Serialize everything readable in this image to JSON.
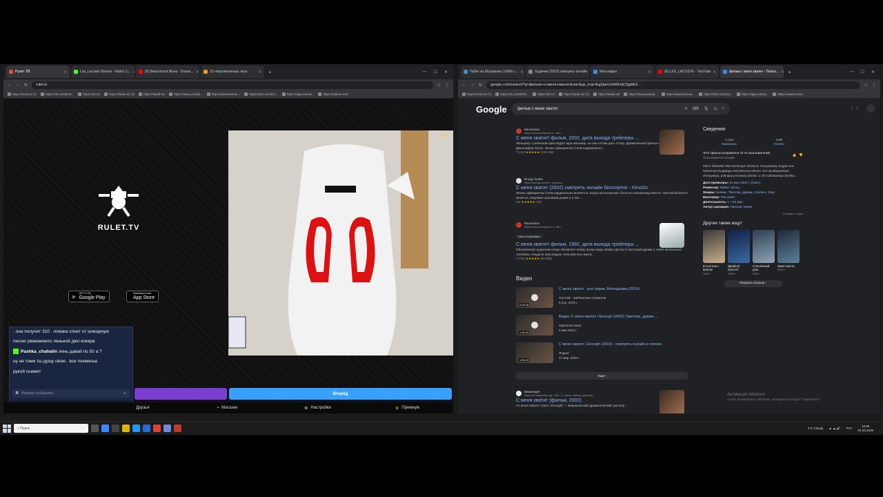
{
  "left_browser": {
    "tabs": [
      {
        "label": "Рулет ТВ",
        "color": "#e74c3c",
        "active": true
      },
      {
        "label": "Los_Lacoste Stream - Watch Li...",
        "color": "#53fc18",
        "active": false
      },
      {
        "label": "(8) Beauxtrrunt Blues - Ocean...",
        "color": "#ff0000",
        "active": false
      },
      {
        "label": "22 непрочитанных чата",
        "color": "#f39c12",
        "active": false
      }
    ],
    "url": "rulet.tv",
    "bookmarks": [
      "https://mail.ru/ (7)",
      "https://vk.com/al?8...",
      "https://ok.ru/",
      "https://tanki.su/ (7)",
      "https://twidd.su/",
      "https://www.youtub...",
      "https://www.itemsu...",
      "https://kick.com/lco...",
      "https://app.instrea...",
      "https://eteimo.mol..."
    ],
    "site": {
      "logo_text": "RULET.TV",
      "google_play": "Google Play",
      "google_play_small": "GET IT ON",
      "app_store": "App Store",
      "app_store_small": "Download on the",
      "video_badge": "★ 25",
      "chat": {
        "line1": ". она получит 310 . лояака споет от шикарную",
        "line2": "песню уважаемого ленькой джо кокера",
        "user": "Pashka_chahalin",
        "user_msg": "лень давай по 50 а ?",
        "line3": "ну не томи ты душу свою . все похмелье",
        "line4": "рукой снимит",
        "input_placeholder": "Напиши сообщение...",
        "footer_user": "Stream: Los_Lacoste",
        "footer_count": "1/1",
        "footer_viewers": "3"
      },
      "next_button": "Вперёд",
      "nav": {
        "friends": "Друзья",
        "shop": "Магазин",
        "settings": "Настройки",
        "premium": "Премиум"
      }
    }
  },
  "right_browser": {
    "tabs": [
      {
        "label": "Побег из Шоушенка (1994) с...",
        "color": "#3c8dde",
        "active": false
      },
      {
        "label": "Ходячие (2023) смотреть онлайн",
        "color": "#888888",
        "active": false
      },
      {
        "label": "Мои видео",
        "color": "#3c8dde",
        "active": false
      },
      {
        "label": "(8) LXD_LACOSTE - YouTube",
        "color": "#ff0000",
        "active": false
      },
      {
        "label": "фильм с меня хватит - Поиск...",
        "color": "#4285f4",
        "active": true
      }
    ],
    "url": "google.com/search?q=фильм+с+меня+хватит&oq=&gs_lcrp=EgZjaHJvbWUqCQgAEC...",
    "bookmarks": [
      "https://mail.ru/ (7)",
      "https://vk.com/al?8...",
      "https://ok.ru/",
      "https://tanki.su/ (7)",
      "https://twidd.su/",
      "https://www.youtub...",
      "https://www.itemsu...",
      "https://kick.com/lco...",
      "https://app.instrea...",
      "https://eteimo.mol..."
    ],
    "google": {
      "logo": "Google",
      "query": "фильм с меня хватит",
      "results": [
        {
          "source": "Кинопоиск",
          "src_url": "https://www.kinopoisk.ru › film",
          "title": "С меня хватит! фильм, 2002, дата выхода трейлеры ...",
          "snippet": "Женщину с ребенком преследует муж-абьюзер, но она готова дать отпор. Драматичный фильм-триллер с Дженнифер Лопес. Жизнь официантки Слим кардинально...",
          "rating": "7,1/10",
          "stars": "★★★★★",
          "votes": "(100 336)"
        },
        {
          "source": "kinogo media",
          "src_url": "https://kinogo.media › фильмы",
          "title": "С меня хватит (2002) смотреть онлайн бесплатно - KinoGo",
          "snippet": "Жизнь официантки Слим кардинально меняется, когда она встречает богатого незнакомца Митча. Они влюбляются, женятся, покупают красивый домик и у них ...",
          "rating": "3,9",
          "stars": "★★★★★",
          "votes": "(75)"
        },
        {
          "source": "Кинопоиск",
          "src_url": "https://www.kinopoisk.ru › film",
          "badge": "Часто открывают",
          "title": "С меня хватит! фильм, 1992, дата выхода трейлеры ...",
          "snippet": "Обозленный неудачник клерк объявляет войну всему миру. Майкл Дуглас в жестокой драме о гневе маленького человека. Неудачи преследуют Уильяма всю жизнь.",
          "rating": "7,7/10",
          "stars": "★★★★★",
          "votes": "(99 408)"
        }
      ],
      "video_section": "Видео",
      "videos": [
        {
          "title": "С меня хватит - все серии. Мелодрама (2019)",
          "meta1": "YouTube · Библиотека Сериалов",
          "meta2": "9 апр. 2019 г.",
          "duration": "2:03:18"
        },
        {
          "title": "Видео С меня хватит / Enough (2002) Триллер, драма ...",
          "meta1": "Одноклассники",
          "meta2": "2 мая 2024 г.",
          "duration": "1:49:42"
        },
        {
          "title": "С меня хватит | Enough (2002) - смотреть онлайн в поиске",
          "meta1": "Яндекс",
          "meta2": "17 мар. 2025 г.",
          "duration": "1:55:12"
        }
      ],
      "more_label": "Ещё",
      "wiki": {
        "source": "Википедия",
        "src_url": "https://ru.wikipedia.org › wiki › С_меня_хватит_(фильм...",
        "title": "С меня хватит (фильм, 2002)",
        "snippet": "«С меня хватит» (англ. Enough) — американский драматический триллер"
      },
      "knowledge": {
        "heading": "Сведения",
        "r1_score": "7,1/10",
        "r1_source": "Кинопоиск",
        "r2_score": "3,9/5",
        "r2_source": "KinoGo",
        "liked": "Этот фильм понравился 72 % пользователей",
        "liked_src": "Пользователи Google",
        "desc": "Zhizn oftsiantki Slim korennym obrazom menyaetsya, kogda ona vstrechaet bogatogo neznakomca Mitcha. Oni vlyublyayutsya, zhenyatsya, pokupayut krasiviy domik i u nih rozhdaetsya dochka.",
        "facts": [
          {
            "k": "Дата премьеры:",
            "v": "21 мая 2002 г. (США)"
          },
          {
            "k": "Режиссер:",
            "v": "Майкл Эптед"
          },
          {
            "k": "Жанры:",
            "v": "Боевик, Триллер, Драма, Саспенс, Ещё"
          },
          {
            "k": "Монтажер:",
            "v": "Рик Шейн"
          },
          {
            "k": "Длительность:",
            "v": "1 ч 55 мин"
          },
          {
            "k": "Автор сценария:",
            "v": "Николас Казан"
          }
        ],
        "feedback": "Оставить отзыв",
        "also_title": "Другие также ищут",
        "posters": [
          {
            "cap": "В постели с врагом",
            "yr": "1991 г."
          },
          {
            "cap": "Двойной просчёт",
            "yr": "1999 г."
          },
          {
            "cap": "Стеклянный дом",
            "yr": "2001 г."
          },
          {
            "cap": "Закон мести",
            "yr": "2009 г."
          }
        ],
        "show_more": "Показать больше"
      },
      "activation_title": "Активация Windows",
      "activation_sub": "Чтобы активировать Windows, перейдите в раздел \"Параметры\"."
    }
  },
  "taskbar": {
    "search": "Поиск",
    "weather": "2°C Cloudy",
    "lang": "РУС",
    "time": "16:59",
    "date": "04.03.2025"
  }
}
